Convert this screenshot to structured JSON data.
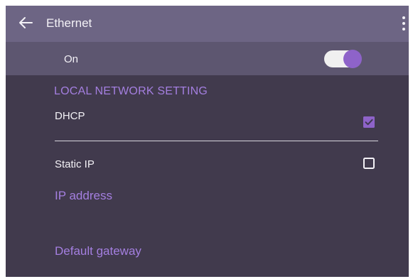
{
  "header": {
    "title": "Ethernet",
    "back_icon": "arrow-left-icon",
    "menu_icon": "more-vertical-icon"
  },
  "ethernet_toggle": {
    "label": "On",
    "state": true
  },
  "local_network": {
    "header": "LOCAL NETWORK SETTING",
    "options": [
      {
        "label": "DHCP",
        "checked": true
      },
      {
        "label": "Static IP",
        "checked": false
      }
    ],
    "fields": {
      "ip_address": "IP address",
      "default_gateway": "Default gateway"
    }
  },
  "colors": {
    "accent": "#8e63c9",
    "section_text": "#a47fe0",
    "topbar": "#6d6584",
    "toggle_row": "#5d5670",
    "background": "#413a4d"
  }
}
